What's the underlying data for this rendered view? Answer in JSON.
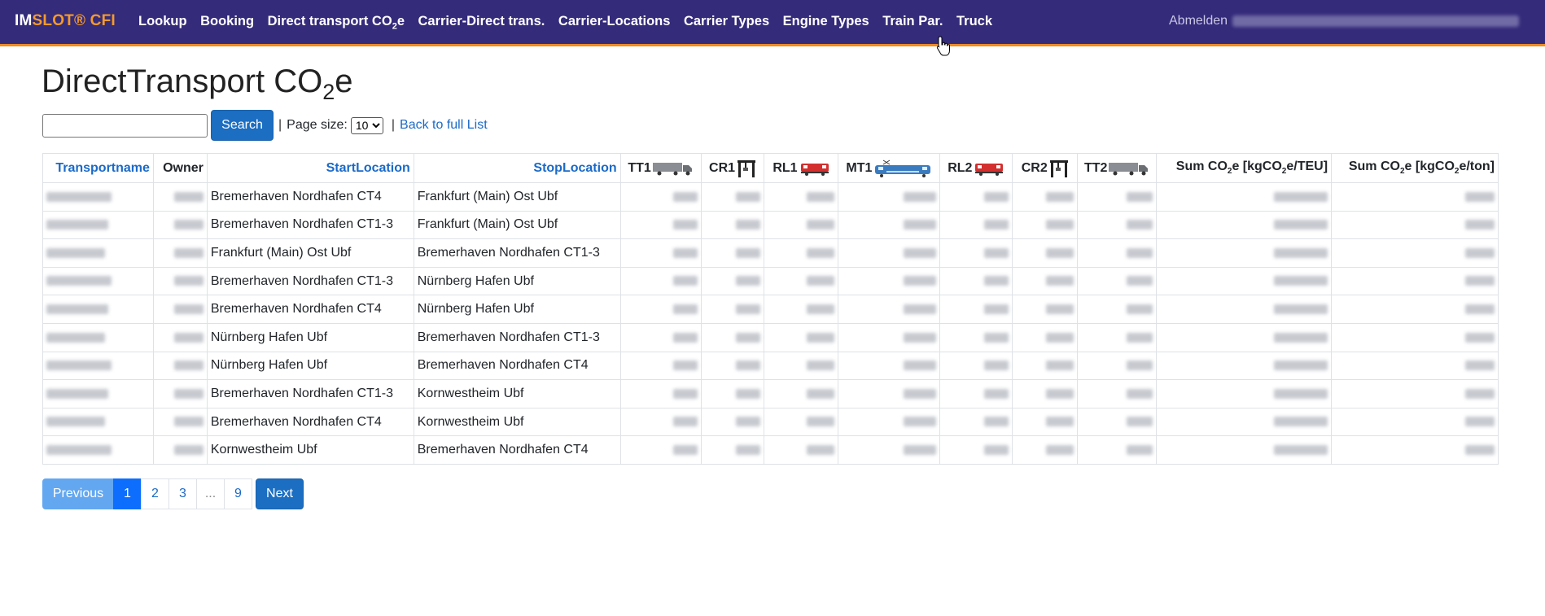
{
  "nav": {
    "brand_prefix": "IM",
    "brand_suffix": "SLOT® CFI",
    "items": [
      {
        "label": "Lookup"
      },
      {
        "label": "Booking"
      },
      {
        "label": "Direct transport CO",
        "sub": "2",
        "suffix": "e"
      },
      {
        "label": "Carrier-Direct trans."
      },
      {
        "label": "Carrier-Locations"
      },
      {
        "label": "Carrier Types"
      },
      {
        "label": "Engine Types"
      },
      {
        "label": "Train Par."
      },
      {
        "label": "Truck"
      }
    ],
    "logout": "Abmelden"
  },
  "page": {
    "title_main": "DirectTransport CO",
    "title_sub": "2",
    "title_suffix": "e"
  },
  "search": {
    "value": "",
    "button": "Search",
    "page_size_label": "Page size:",
    "page_size_value": "10",
    "back_link": "Back to full List",
    "separator": "|"
  },
  "table": {
    "headers": {
      "transportname": "Transportname",
      "owner": "Owner",
      "start": "StartLocation",
      "stop": "StopLocation",
      "tt1": "TT1",
      "cr1": "CR1",
      "rl1": "RL1",
      "mt1": "MT1",
      "rl2": "RL2",
      "cr2": "CR2",
      "tt2": "TT2",
      "sum_teu_a": "Sum CO",
      "sum_teu_b": "e [kgCO",
      "sum_teu_c": "e/TEU]",
      "sum_ton_a": "Sum CO",
      "sum_ton_b": "e [kgCO",
      "sum_ton_c": "e/ton]",
      "sub2": "2"
    },
    "rows": [
      {
        "start": "Bremerhaven Nordhafen CT4",
        "stop": "Frankfurt (Main) Ost Ubf"
      },
      {
        "start": "Bremerhaven Nordhafen CT1-3",
        "stop": "Frankfurt (Main) Ost Ubf"
      },
      {
        "start": "Frankfurt (Main) Ost Ubf",
        "stop": "Bremerhaven Nordhafen CT1-3"
      },
      {
        "start": "Bremerhaven Nordhafen CT1-3",
        "stop": "Nürnberg Hafen Ubf"
      },
      {
        "start": "Bremerhaven Nordhafen CT4",
        "stop": "Nürnberg Hafen Ubf"
      },
      {
        "start": "Nürnberg Hafen Ubf",
        "stop": "Bremerhaven Nordhafen CT1-3"
      },
      {
        "start": "Nürnberg Hafen Ubf",
        "stop": "Bremerhaven Nordhafen CT4"
      },
      {
        "start": "Bremerhaven Nordhafen CT1-3",
        "stop": "Kornwestheim Ubf"
      },
      {
        "start": "Bremerhaven Nordhafen CT4",
        "stop": "Kornwestheim Ubf"
      },
      {
        "start": "Kornwestheim Ubf",
        "stop": "Bremerhaven Nordhafen CT4"
      }
    ]
  },
  "pagination": {
    "previous": "Previous",
    "pages": [
      "1",
      "2",
      "3"
    ],
    "ellipsis": "...",
    "last": "9",
    "next": "Next"
  },
  "colors": {
    "navbar": "#342b7a",
    "accent": "#f08a24",
    "link": "#1a6ac8",
    "button": "#1b6ec2"
  },
  "icons": {
    "truck": "truck-icon",
    "crane": "crane-icon",
    "locomotive": "locomotive-icon",
    "train": "electric-train-icon"
  }
}
